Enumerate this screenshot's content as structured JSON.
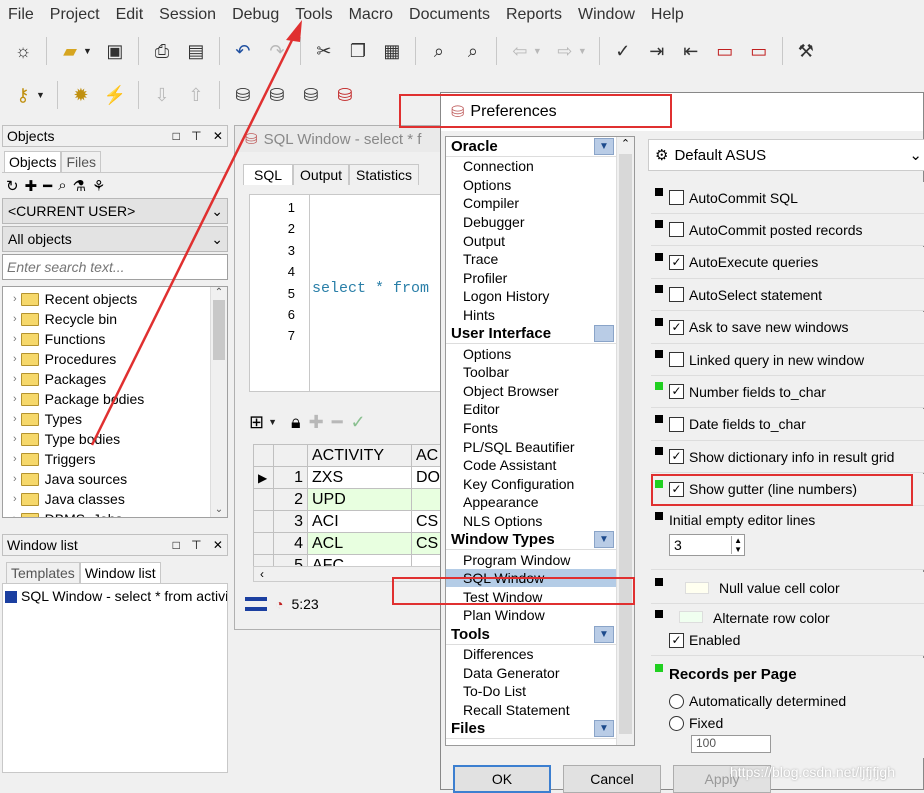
{
  "menu": [
    "File",
    "Project",
    "Edit",
    "Session",
    "Debug",
    "Tools",
    "Macro",
    "Documents",
    "Reports",
    "Window",
    "Help"
  ],
  "objects_panel": {
    "title": "Objects",
    "tabs": [
      "Objects",
      "Files"
    ],
    "user_combo": "<CURRENT USER>",
    "filter_combo": "All objects",
    "search_placeholder": "Enter search text...",
    "items": [
      "Recent objects",
      "Recycle bin",
      "Functions",
      "Procedures",
      "Packages",
      "Package bodies",
      "Types",
      "Type bodies",
      "Triggers",
      "Java sources",
      "Java classes",
      "DBMS_Jobs"
    ]
  },
  "window_list": {
    "title": "Window list",
    "tabs": [
      "Templates",
      "Window list"
    ],
    "item": "SQL Window - select * from activity"
  },
  "sql_window": {
    "title": "SQL Window - select * f",
    "tabs": [
      "SQL",
      "Output",
      "Statistics"
    ],
    "line_numbers": [
      "1",
      "2",
      "3",
      "4",
      "5",
      "6",
      "7"
    ],
    "code": "select * from",
    "grid_headers": [
      "ACTIVITY",
      "AC"
    ],
    "grid_rows": [
      {
        "n": "1",
        "a": "ZXS",
        "b": "DO"
      },
      {
        "n": "2",
        "a": "UPD",
        "b": ""
      },
      {
        "n": "3",
        "a": "ACI",
        "b": "CS"
      },
      {
        "n": "4",
        "a": "ACL",
        "b": "CS"
      },
      {
        "n": "5",
        "a": "AFC",
        "b": ""
      }
    ],
    "status_time": "5:23"
  },
  "preferences": {
    "title": "Preferences",
    "profile": "Default ASUS",
    "categories": [
      {
        "name": "Oracle",
        "items": [
          "Connection",
          "Options",
          "Compiler",
          "Debugger",
          "Output",
          "Trace",
          "Profiler",
          "Logon History",
          "Hints"
        ]
      },
      {
        "name": "User Interface",
        "items": [
          "Options",
          "Toolbar",
          "Object Browser",
          "Editor",
          "Fonts",
          "PL/SQL Beautifier",
          "Code Assistant",
          "Key Configuration",
          "Appearance",
          "NLS Options"
        ]
      },
      {
        "name": "Window Types",
        "items": [
          "Program Window",
          "SQL Window",
          "Test Window",
          "Plan Window"
        ]
      },
      {
        "name": "Tools",
        "items": [
          "Differences",
          "Data Generator",
          "To-Do List",
          "Recall Statement"
        ]
      },
      {
        "name": "Files",
        "items": []
      }
    ],
    "options": [
      {
        "label": "AutoCommit SQL",
        "checked": false
      },
      {
        "label": "AutoCommit posted records",
        "checked": false
      },
      {
        "label": "AutoExecute queries",
        "checked": true
      },
      {
        "label": "AutoSelect statement",
        "checked": false
      },
      {
        "label": "Ask to save new windows",
        "checked": true
      },
      {
        "label": "Linked query in new window",
        "checked": false
      },
      {
        "label": "Number fields to_char",
        "checked": true
      },
      {
        "label": "Date fields to_char",
        "checked": false
      },
      {
        "label": "Show dictionary info in result grid",
        "checked": true
      },
      {
        "label": "Show gutter (line numbers)",
        "checked": true
      }
    ],
    "initial_lines_label": "Initial empty editor lines",
    "initial_lines_value": "3",
    "null_color_label": "Null value cell color",
    "alt_row_label": "Alternate row color",
    "enabled_label": "Enabled",
    "records_title": "Records per Page",
    "auto_label": "Automatically determined",
    "fixed_label": "Fixed",
    "fixed_value": "100",
    "ok": "OK",
    "cancel": "Cancel",
    "apply": "Apply"
  },
  "watermark": "https://blog.csdn.net/ljfjfjgh"
}
